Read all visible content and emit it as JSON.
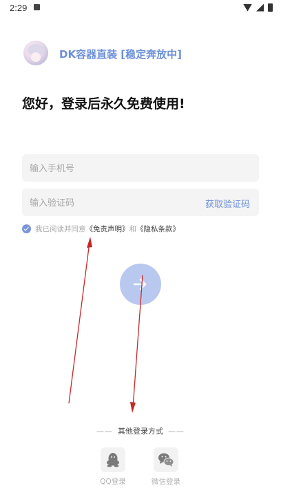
{
  "status_bar": {
    "time": "2:29"
  },
  "header": {
    "app_title": "DK容器直装 [稳定奔放中]"
  },
  "welcome_text": "您好，登录后永久免费使用!",
  "form": {
    "phone_placeholder": "输入手机号",
    "code_placeholder": "输入验证码",
    "get_code_label": "获取验证码"
  },
  "agreement": {
    "checked": true,
    "prefix": "我已阅读并同意",
    "disclaimer_link": "《免责声明》",
    "and": "和",
    "privacy_link": "《隐私条款》"
  },
  "other_login": {
    "title": "其他登录方式",
    "dash": "——",
    "qq_label": "QQ登录",
    "wechat_label": "微信登录"
  },
  "colors": {
    "accent": "#6b8fd9",
    "submit_button": "#b9c8ef",
    "input_background": "#f4f4f5",
    "annotation_arrow": "#c62828"
  },
  "icons": {
    "submit": "arrow-right-icon",
    "qq": "qq-penguin-icon",
    "wechat": "wechat-chat-icon"
  }
}
